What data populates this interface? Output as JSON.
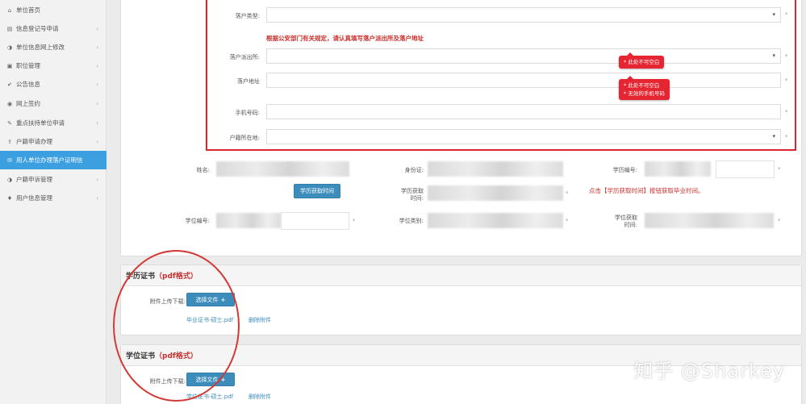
{
  "sidebar": {
    "items": [
      {
        "label": "单位首页",
        "icon": "home-icon",
        "glyph": "⌂",
        "chevron": false,
        "active": false
      },
      {
        "label": "信息登记号申请",
        "icon": "file-icon",
        "glyph": "▤",
        "chevron": true,
        "active": false
      },
      {
        "label": "单位信息网上修改",
        "icon": "adjust-icon",
        "glyph": "◑",
        "chevron": true,
        "active": false
      },
      {
        "label": "职位管理",
        "icon": "briefcase-icon",
        "glyph": "▣",
        "chevron": true,
        "active": false
      },
      {
        "label": "公告信息",
        "icon": "check-icon",
        "glyph": "✔",
        "chevron": true,
        "active": false
      },
      {
        "label": "网上签约",
        "icon": "eye-icon",
        "glyph": "◉",
        "chevron": true,
        "active": false
      },
      {
        "label": "重点扶持单位申请",
        "icon": "pin-icon",
        "glyph": "✎",
        "chevron": true,
        "active": false
      },
      {
        "label": "户籍申请办理",
        "icon": "upload-icon",
        "glyph": "⇪",
        "chevron": true,
        "active": false
      },
      {
        "label": "用人单位办理落户证明信",
        "icon": "envelope-icon",
        "glyph": "✉",
        "chevron": false,
        "active": true
      },
      {
        "label": "户籍申诉管理",
        "icon": "adjust-icon",
        "glyph": "◑",
        "chevron": true,
        "active": false
      },
      {
        "label": "用户信息管理",
        "icon": "bell-icon",
        "glyph": "♦",
        "chevron": true,
        "active": false
      }
    ]
  },
  "settle": {
    "type_label": "落户类型:",
    "notice": "根据公安部门有关规定，请认真填写落户派出所及落户地址",
    "station_label": "落户派出所:",
    "address_label": "落户地址",
    "phone_label": "手机号码:",
    "residence_label": "户籍所在地:",
    "required_mark": "*",
    "tip1": "* 此处不可空白",
    "tip2_line1": "* 此处不可空白",
    "tip2_line2": "* 无效的手机号码"
  },
  "person": {
    "name_label": "姓名:",
    "id_label": "身份证:",
    "edu_no_label": "学历编号:",
    "get_time_button": "学历获取时间",
    "edu_time_label_l1": "学历获取",
    "edu_time_label_l2": "时间:",
    "hint": "点击【学历获取时间】按钮获取毕业时间。",
    "degree_no_label": "学位编号:",
    "degree_type_label": "学位类别:",
    "degree_time_label_l1": "学位获取",
    "degree_time_label_l2": "时间:"
  },
  "edu_cert": {
    "title": "学历证书",
    "format": "（pdf格式）",
    "upload_label": "附件上传下载:",
    "choose_button": "选择文件",
    "file_name": "毕业证书-硕士.pdf",
    "delete_link": "删除附件"
  },
  "degree_cert": {
    "title": "学位证书",
    "format": "（pdf格式）",
    "upload_label": "附件上传下载:",
    "choose_button": "选择文件",
    "file_name": "学位证书-硕士.pdf",
    "delete_link": "删除附件"
  },
  "watermark": "知乎 @Sharkey",
  "colors": {
    "accent": "#3b9fe0",
    "button": "#3c8dbc",
    "error": "#e52531",
    "annotation": "#d9262f"
  }
}
